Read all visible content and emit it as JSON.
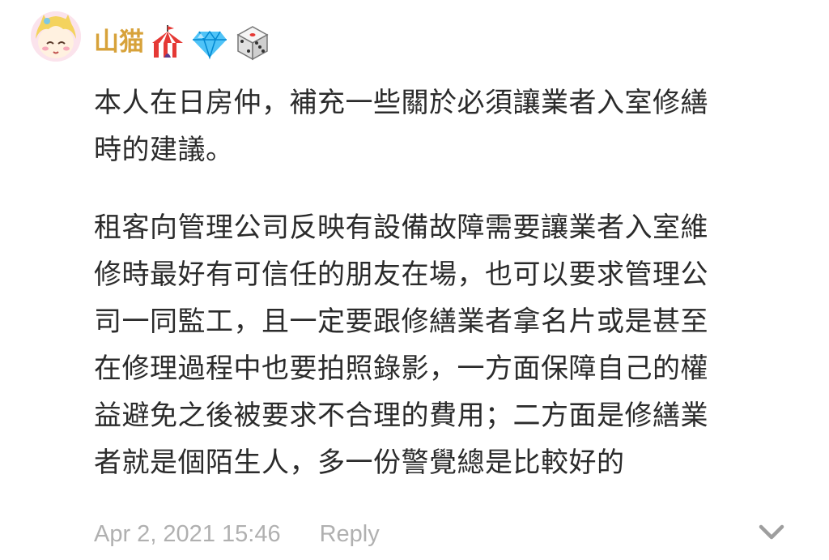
{
  "post": {
    "author": {
      "name": "山猫",
      "badges": [
        "circus-tent-icon",
        "gem-icon",
        "dice-icon"
      ],
      "name_color": "#d7a23a"
    },
    "paragraphs": [
      {
        "lines": [
          "本人在日房仲，補充一些關於必須讓業者入室修繕",
          "時的建議。"
        ]
      },
      {
        "lines": [
          "租客向管理公司反映有設備故障需要讓業者入室維",
          "修時最好有可信任的朋友在場，也可以要求管理公",
          "司一同監工，且一定要跟修繕業者拿名片或是甚至",
          "在修理過程中也要拍照錄影，一方面保障自己的權",
          "益避免之後被要求不合理的費用；二方面是修繕業",
          "者就是個陌生人，多一份警覺總是比較好的"
        ]
      }
    ],
    "timestamp": "Apr 2, 2021 15:46",
    "reply_label": "Reply",
    "expand_icon": "chevron-down-icon"
  },
  "colors": {
    "text": "#2b2b2b",
    "meta": "#b0b0b0"
  }
}
